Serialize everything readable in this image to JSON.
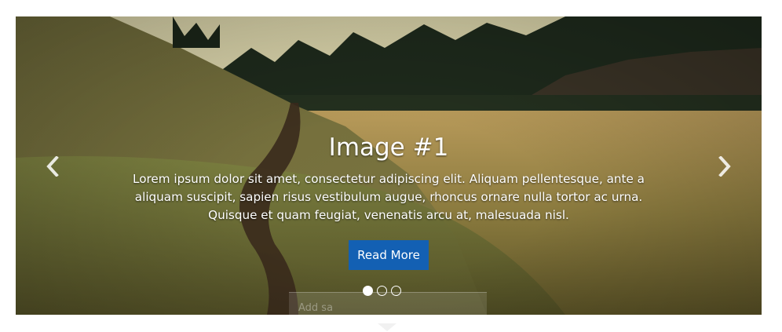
{
  "slide": {
    "title": "Image #1",
    "text": "Lorem ipsum dolor sit amet, consectetur adipiscing elit. Aliquam pellentesque, ante a aliquam suscipit, sapien risus vestibulum augue, rhoncus ornare nulla tortor ac urna. Quisque et quam feugiat, venenatis arcu at, malesuada nisl.",
    "button_label": "Read More",
    "image": "meadow-trail-forest-landscape"
  },
  "controls": {
    "prev_icon": "chevron-left-icon",
    "next_icon": "chevron-right-icon",
    "indicators": [
      {
        "active": true
      },
      {
        "active": false
      },
      {
        "active": false
      }
    ]
  },
  "overlay": {
    "placeholder": "Add sa"
  },
  "colors": {
    "button_bg": "#1360b3",
    "caption_text": "#ffffff"
  }
}
